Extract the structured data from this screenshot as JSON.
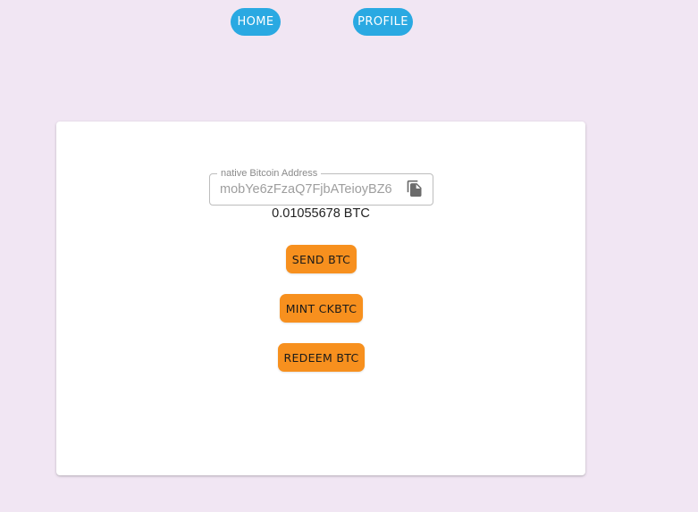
{
  "nav": {
    "home_label": "HOME",
    "profile_label": "PROFILE"
  },
  "wallet": {
    "address_label": "native Bitcoin Address",
    "address_value": "mobYe6zFzaQ7FjbATeioyBZ6",
    "copy_icon": "copy-icon",
    "balance": "0.01055678 BTC"
  },
  "actions": {
    "send_label": "SEND BTC",
    "mint_label": "MINT CKBTC",
    "redeem_label": "REDEEM BTC"
  },
  "colors": {
    "page_background": "#f1e6f3",
    "nav_button": "#2aa9e2",
    "action_button": "#f7901e",
    "card": "#ffffff"
  }
}
